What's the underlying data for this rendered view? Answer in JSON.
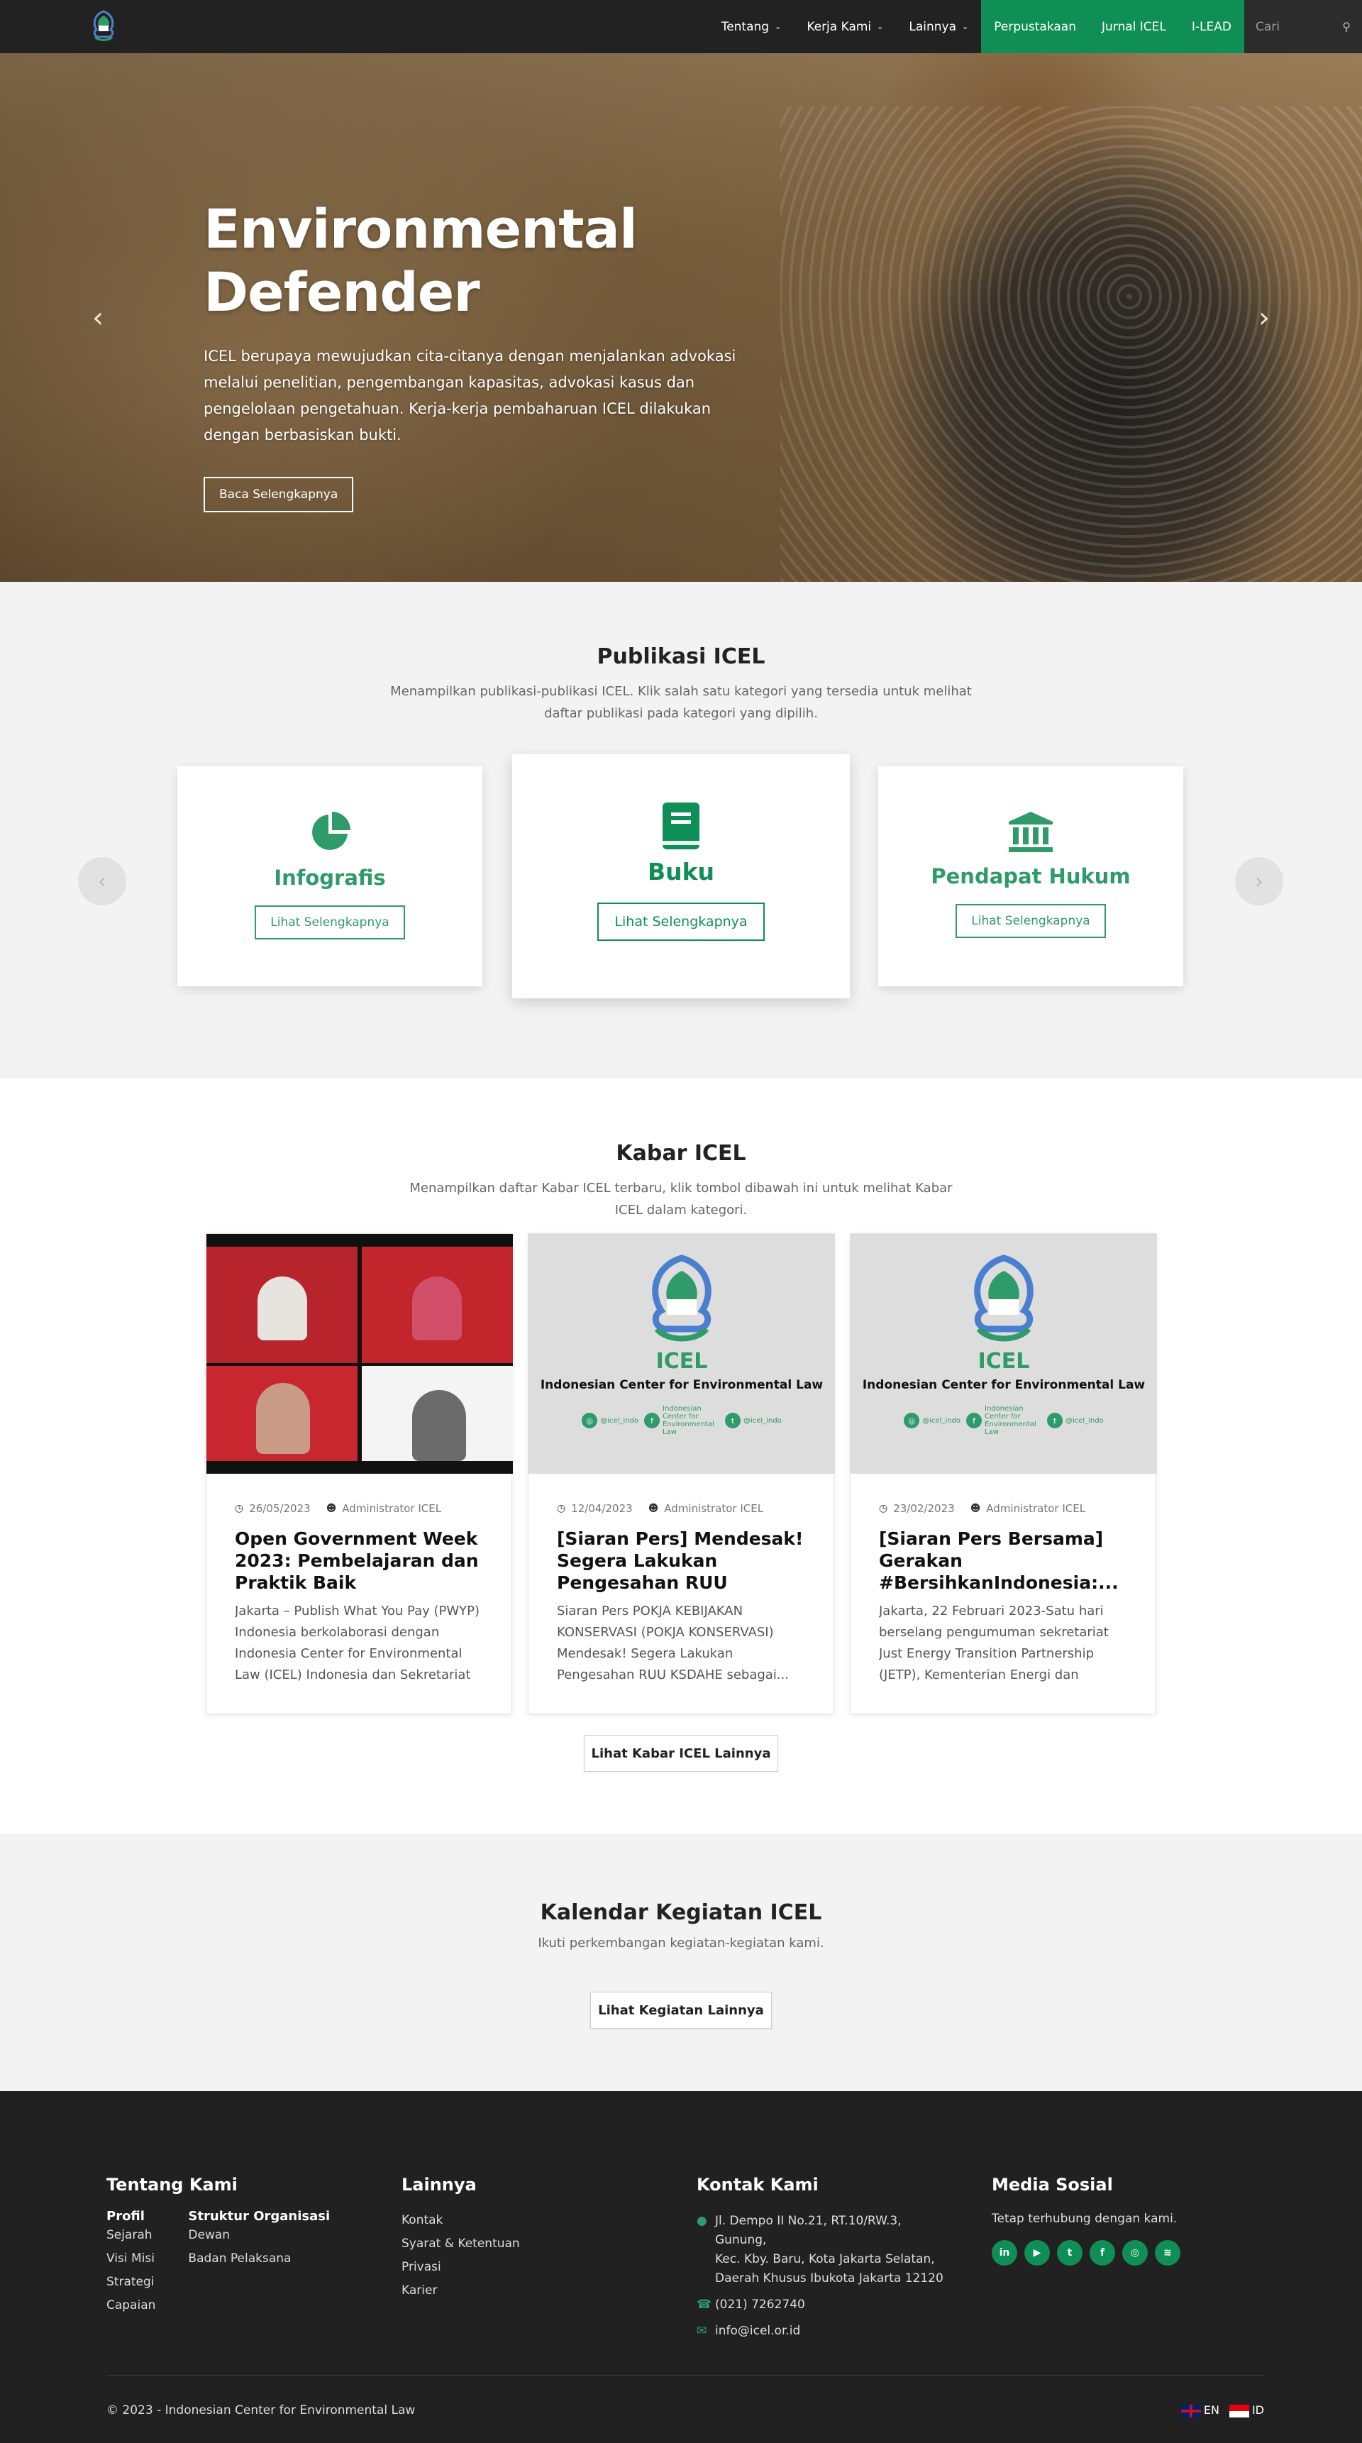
{
  "nav": {
    "items": [
      {
        "label": "Tentang",
        "dropdown": true
      },
      {
        "label": "Kerja Kami",
        "dropdown": true
      },
      {
        "label": "Lainnya",
        "dropdown": true
      }
    ],
    "green_items": [
      "Perpustakaan",
      "Jurnal ICEL",
      "I-LEAD"
    ],
    "search_placeholder": "Cari",
    "accent": "#0f8f55"
  },
  "hero": {
    "title": "Environmental Defender",
    "text": "ICEL berupaya mewujudkan cita-citanya dengan menjalankan advokasi melalui penelitian, pengembangan kapasitas, advokasi kasus dan pengelolaan pengetahuan. Kerja-kerja pembaharuan ICEL dilakukan dengan berbasiskan bukti.",
    "button": "Baca Selengkapnya"
  },
  "publikasi": {
    "title": "Publikasi ICEL",
    "subtitle": "Menampilkan publikasi-publikasi ICEL. Klik salah satu kategori yang tersedia untuk melihat daftar publikasi pada kategori yang dipilih.",
    "cards": [
      {
        "title": "Infografis",
        "button": "Lihat Selengkapnya",
        "icon": "pie-chart-icon"
      },
      {
        "title": "Buku",
        "button": "Lihat Selengkapnya",
        "icon": "book-icon"
      },
      {
        "title": "Pendapat Hukum",
        "button": "Lihat Selengkapnya",
        "icon": "institution-icon"
      }
    ]
  },
  "kabar": {
    "title": "Kabar ICEL",
    "subtitle": "Menampilkan daftar Kabar ICEL terbaru, klik tombol dibawah ini untuk melihat Kabar ICEL dalam kategori.",
    "thumb_name": "Indonesian Center for Environmental Law",
    "thumb_brand": "ICEL",
    "thumb_handles": [
      "@icel_indo",
      "Indonesian Center for Environmental Law",
      "@icel_indo",
      "Indonesian Center for Environmental Law"
    ],
    "posts": [
      {
        "date": "26/05/2023",
        "author": "Administrator ICEL",
        "title": "Open Government Week 2023: Pembelajaran dan Praktik Baik Keterbukaan...",
        "excerpt": "Jakarta – Publish What You Pay (PWYP) Indonesia berkolaborasi dengan Indonesia Center for Environmental Law (ICEL) Indonesia dan Sekretariat Open..."
      },
      {
        "date": "12/04/2023",
        "author": "Administrator ICEL",
        "title": "[Siaran Pers] Mendesak! Segera Lakukan Pengesahan RUU KSDAHE sebagai...",
        "excerpt": "Siaran Pers POKJA KEBIJAKAN KONSERVASI (POKJA KONSERVASI) Mendesak! Segera Lakukan Pengesahan RUU KSDAHE sebagai..."
      },
      {
        "date": "23/02/2023",
        "author": "Administrator ICEL",
        "title": "[Siaran Pers Bersama] Gerakan #BersihkanIndonesia:...",
        "excerpt": "Jakarta, 22 Februari 2023-Satu hari berselang pengumuman sekretariat Just Energy Transition Partnership (JETP), Kementerian Energi dan Sumb..."
      }
    ],
    "more_button": "Lihat Kabar ICEL Lainnya"
  },
  "kalendar": {
    "title": "Kalendar Kegiatan ICEL",
    "subtitle": "Ikuti perkembangan kegiatan-kegiatan kami.",
    "button": "Lihat Kegiatan Lainnya"
  },
  "footer": {
    "tentang": {
      "title": "Tentang Kami",
      "profil_heading": "Profil",
      "profil_links": [
        "Sejarah",
        "Visi Misi",
        "Strategi",
        "Capaian"
      ],
      "struktur_heading": "Struktur Organisasi",
      "struktur_links": [
        "Dewan",
        "Badan Pelaksana"
      ]
    },
    "lainnya": {
      "title": "Lainnya",
      "links": [
        "Kontak",
        "Syarat & Ketentuan",
        "Privasi",
        "Karier"
      ]
    },
    "kontak": {
      "title": "Kontak Kami",
      "address_lines": [
        "Jl. Dempo II No.21, RT.10/RW.3, Gunung,",
        "Kec. Kby. Baru, Kota Jakarta Selatan,",
        "Daerah Khusus Ibukota Jakarta 12120"
      ],
      "phone": "(021) 7262740",
      "email": "info@icel.or.id"
    },
    "media": {
      "title": "Media Sosial",
      "text": "Tetap terhubung dengan kami."
    },
    "copyright": "© 2023 - Indonesian Center for Environmental Law",
    "lang_en": "EN",
    "lang_id": "ID"
  }
}
